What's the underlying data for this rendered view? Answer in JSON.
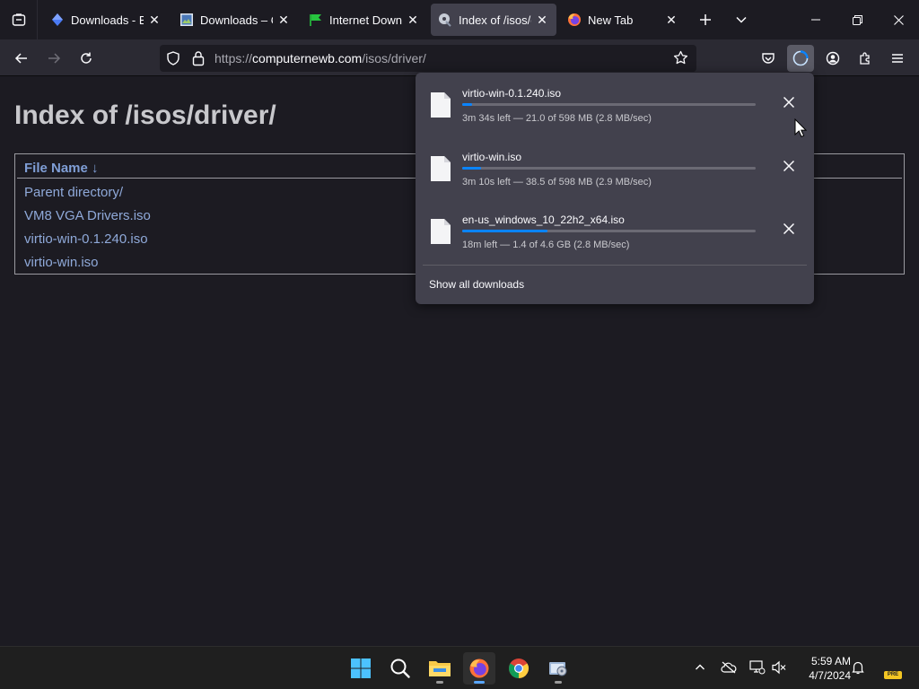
{
  "browser": {
    "tabs": [
      {
        "title": "Downloads - Bo",
        "icon": "blue-diamond-icon",
        "active": false
      },
      {
        "title": "Downloads – Or",
        "icon": "image-icon",
        "active": false
      },
      {
        "title": "Internet Downlo",
        "icon": "green-flag-icon",
        "active": false
      },
      {
        "title": "Index of /isos/dr",
        "icon": "disc-icon",
        "active": true
      },
      {
        "title": "New Tab",
        "icon": "firefox-icon",
        "active": false
      }
    ],
    "url": {
      "prefix": "https://",
      "domain": "computernewb.com",
      "path": "/isos/driver/"
    }
  },
  "page": {
    "heading": "Index of /isos/driver/",
    "column_header": "File Name  ↓",
    "entries": [
      "Parent directory/",
      "VM8 VGA Drivers.iso",
      "virtio-win-0.1.240.iso",
      "virtio-win.iso"
    ]
  },
  "downloads_panel": {
    "items": [
      {
        "name": "virtio-win-0.1.240.iso",
        "status": "3m 34s left — 21.0 of 598 MB (2.8 MB/sec)",
        "progress": 0.035
      },
      {
        "name": "virtio-win.iso",
        "status": "3m 10s left — 38.5 of 598 MB (2.9 MB/sec)",
        "progress": 0.064
      },
      {
        "name": "en-us_windows_10_22h2_x64.iso",
        "status": "18m left — 1.4 of 4.6 GB (2.8 MB/sec)",
        "progress": 0.29
      }
    ],
    "show_all_label": "Show all downloads"
  },
  "taskbar": {
    "time": "5:59 AM",
    "date": "4/7/2024",
    "badge": "PRE"
  },
  "colors": {
    "accent": "#0a84ff",
    "link": "#8fa9d9",
    "panel": "#42414d"
  }
}
